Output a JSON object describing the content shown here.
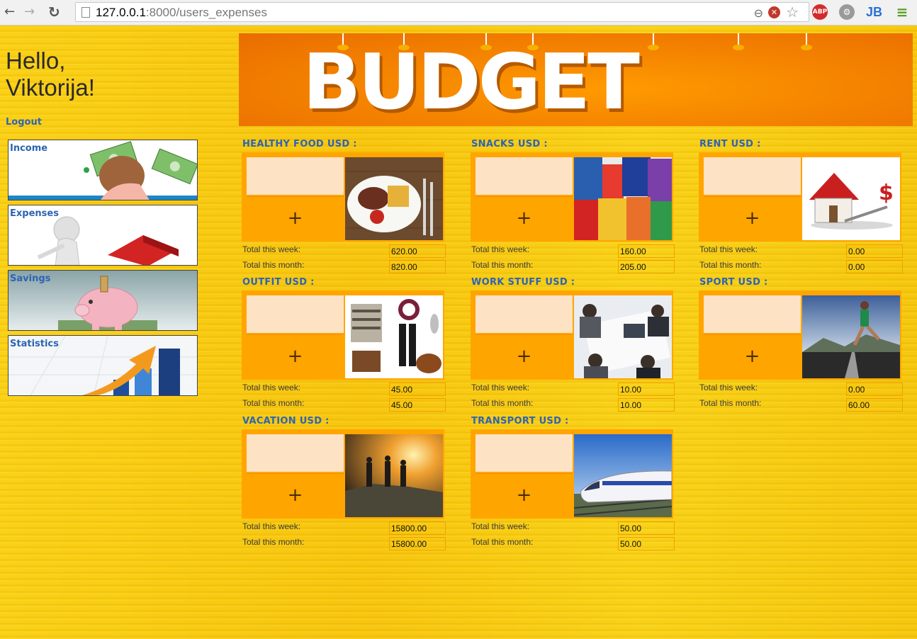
{
  "browser": {
    "url_host": "127.0.0.1",
    "url_rest": ":8000/users_expenses",
    "ext_abp": "ABP",
    "ext_jb": "JB"
  },
  "greeting": {
    "line1": "Hello,",
    "line2": "Viktorija!"
  },
  "logout_label": "Logout",
  "nav": [
    {
      "label": "Income",
      "icon": "money-bag-image"
    },
    {
      "label": "Expenses",
      "icon": "figure-with-house-image"
    },
    {
      "label": "Savings",
      "icon": "piggy-bank-image"
    },
    {
      "label": "Statistics",
      "icon": "growth-chart-image"
    }
  ],
  "banner_title": "BUDGET",
  "week_label": "Total this week:",
  "month_label": "Total this month:",
  "add_symbol": "+",
  "categories": [
    {
      "title": "HEALTHY FOOD USD :",
      "week": "620.00",
      "month": "820.00",
      "image": "food-plate-image"
    },
    {
      "title": "SNACKS USD :",
      "week": "160.00",
      "month": "205.00",
      "image": "snacks-image"
    },
    {
      "title": "RENT USD :",
      "week": "0.00",
      "month": "0.00",
      "image": "house-rent-image"
    },
    {
      "title": "OUTFIT USD :",
      "week": "45.00",
      "month": "45.00",
      "image": "clothes-image"
    },
    {
      "title": "WORK STUFF USD :",
      "week": "10.00",
      "month": "10.00",
      "image": "office-meeting-image"
    },
    {
      "title": "SPORT USD :",
      "week": "0.00",
      "month": "60.00",
      "image": "runner-image"
    },
    {
      "title": "VACATION USD :",
      "week": "15800.00",
      "month": "15800.00",
      "image": "hikers-sunset-image"
    },
    {
      "title": "TRANSPORT USD :",
      "week": "50.00",
      "month": "50.00",
      "image": "train-image"
    }
  ]
}
